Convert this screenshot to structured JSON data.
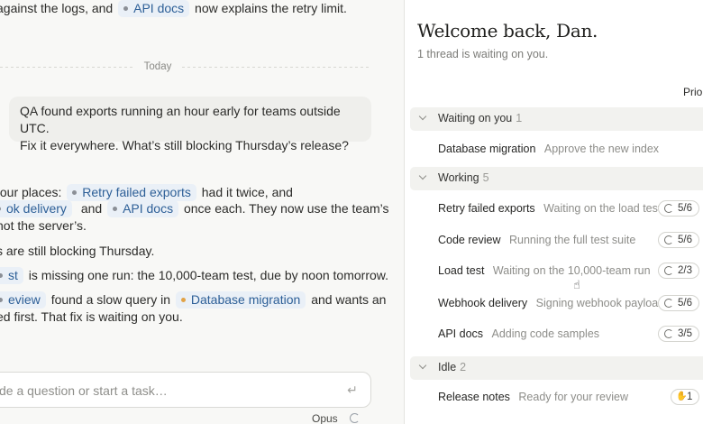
{
  "chat": {
    "line0": {
      "a": "against the logs, and",
      "chip": "API docs",
      "b": "now explains the retry limit."
    },
    "divider_label": "Today",
    "user_message": {
      "line1": "QA found exports running an hour early for teams outside UTC.",
      "line2": "Fix it everywhere. What’s still blocking Thursday’s release?"
    },
    "reply": {
      "l1a": "four places:",
      "l1chip": "Retry failed exports",
      "l1b": "had it twice, and",
      "l2chip1": "ok delivery",
      "l2a": "and",
      "l2chip2": "API docs",
      "l2b": "once each. They now use the team’s",
      "l3": "not the server’s.",
      "l4": "s are still blocking Thursday.",
      "l5chip": "st",
      "l5b": "is missing one run: the 10,000-team test, due by noon tomorrow.",
      "l6chip1": "eview",
      "l6a": "found a slow query in",
      "l6chip2": "Database migration",
      "l6b": "and wants an",
      "l7": "ed first. That fix is waiting on you."
    },
    "composer": {
      "placeholder": "de a question or start a task…",
      "enter_icon": "↵",
      "model": "Opus"
    }
  },
  "panel": {
    "welcome": "Welcome back, Dan.",
    "subtitle": "1 thread is waiting on you.",
    "column_header": "Prio",
    "groups": [
      {
        "name": "Waiting on you",
        "count": "1",
        "items": [
          {
            "name": "Database migration",
            "status": "Approve the new index"
          }
        ]
      },
      {
        "name": "Working",
        "count": "5",
        "items": [
          {
            "name": "Retry failed exports",
            "status": "Waiting on the load test",
            "progress": "5/6"
          },
          {
            "name": "Code review",
            "status": "Running the full test suite",
            "progress": "5/6"
          },
          {
            "name": "Load test",
            "status": "Waiting on the 10,000-team run",
            "progress": "2/3"
          },
          {
            "name": "Webhook delivery",
            "status": "Signing webhook payloads",
            "progress": "5/6"
          },
          {
            "name": "API docs",
            "status": "Adding code samples",
            "progress": "3/5"
          }
        ]
      },
      {
        "name": "Idle",
        "count": "2",
        "items": [
          {
            "name": "Release notes",
            "status": "Ready for your review",
            "badge": "1",
            "badge_icon": "hand-icon"
          }
        ]
      }
    ]
  },
  "colors": {
    "chip_bg": "#eaf0f7",
    "chip_text": "#2d5f97",
    "accent_orange": "#e2a347"
  }
}
